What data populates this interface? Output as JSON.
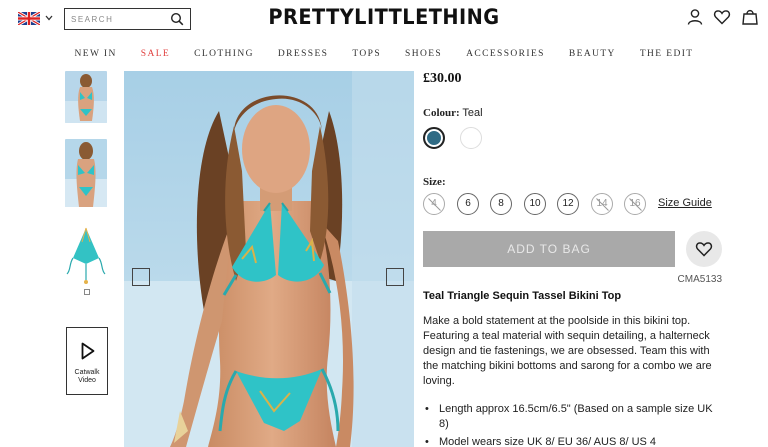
{
  "header": {
    "search_placeholder": "SEARCH",
    "logo": "PRETTYLITTLETHING",
    "icons": [
      "uk-flag-icon",
      "chevron-down-icon",
      "search-icon",
      "account-icon",
      "heart-icon",
      "bag-icon"
    ]
  },
  "nav": {
    "items": [
      "NEW IN",
      "SALE",
      "CLOTHING",
      "DRESSES",
      "TOPS",
      "SHOES",
      "ACCESSORIES",
      "BEAUTY",
      "THE EDIT"
    ]
  },
  "gallery": {
    "catwalk_label_line1": "Catwalk",
    "catwalk_label_line2": "Video"
  },
  "product": {
    "price": "£30.00",
    "colour_label": "Colour:",
    "colour_value": "Teal",
    "swatches": [
      {
        "name": "teal",
        "color": "#2f6b85",
        "selected": true
      },
      {
        "name": "white",
        "color": "#ffffff",
        "selected": false
      }
    ],
    "size_label": "Size:",
    "sizes": [
      {
        "label": "4",
        "available": false
      },
      {
        "label": "6",
        "available": true
      },
      {
        "label": "8",
        "available": true
      },
      {
        "label": "10",
        "available": true
      },
      {
        "label": "12",
        "available": true
      },
      {
        "label": "14",
        "available": false
      },
      {
        "label": "16",
        "available": false
      }
    ],
    "size_guide": "Size Guide",
    "add_to_bag": "ADD TO BAG",
    "sku": "CMA5133",
    "title": "Teal Triangle Sequin Tassel Bikini Top",
    "description": "Make a bold statement at the poolside in this bikini top. Featuring a teal material with sequin detailing, a halterneck design and tie fastenings, we are obsessed. Team this with the matching bikini bottoms and sarong for a combo we are loving.",
    "bullets": [
      "Length approx 16.5cm/6.5\" (Based on a sample size UK 8)",
      "Model wears size UK 8/ EU 36/ AUS 8/ US 4"
    ]
  },
  "colors": {
    "sale": "#e0403f",
    "add_to_bag_bg": "#a9a9a9",
    "teal": "#2f6b85"
  }
}
